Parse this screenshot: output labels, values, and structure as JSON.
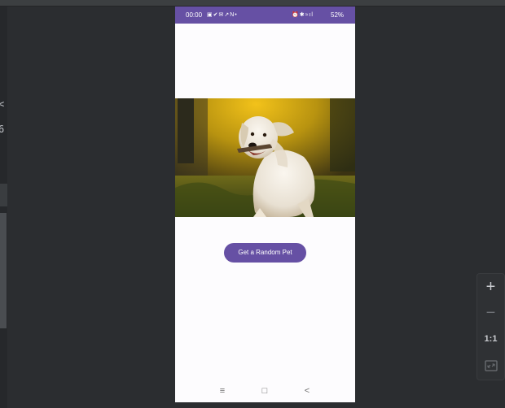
{
  "ide": {
    "left_edge_chars": [
      "<",
      "6"
    ]
  },
  "device": {
    "status_bar": {
      "time": "00:00",
      "left_icons": "▣✔✉↗N•",
      "right_icons": "⏰✱≈ıl",
      "battery": "52%"
    },
    "pet_image": {
      "subject": "golden retriever running with stick"
    },
    "random_button_label": "Get a Random Pet",
    "nav_bar": {
      "recents_glyph": "≡",
      "home_glyph": "□",
      "back_glyph": "<"
    }
  },
  "zoom_controls": {
    "zoom_in": "+",
    "zoom_out": "−",
    "actual_size": "1:1",
    "fit_icon": "fit-screen-icon"
  },
  "colors": {
    "accent": "#6650a4",
    "ide_background": "#2b2d30",
    "app_background": "#fdfcfe"
  }
}
